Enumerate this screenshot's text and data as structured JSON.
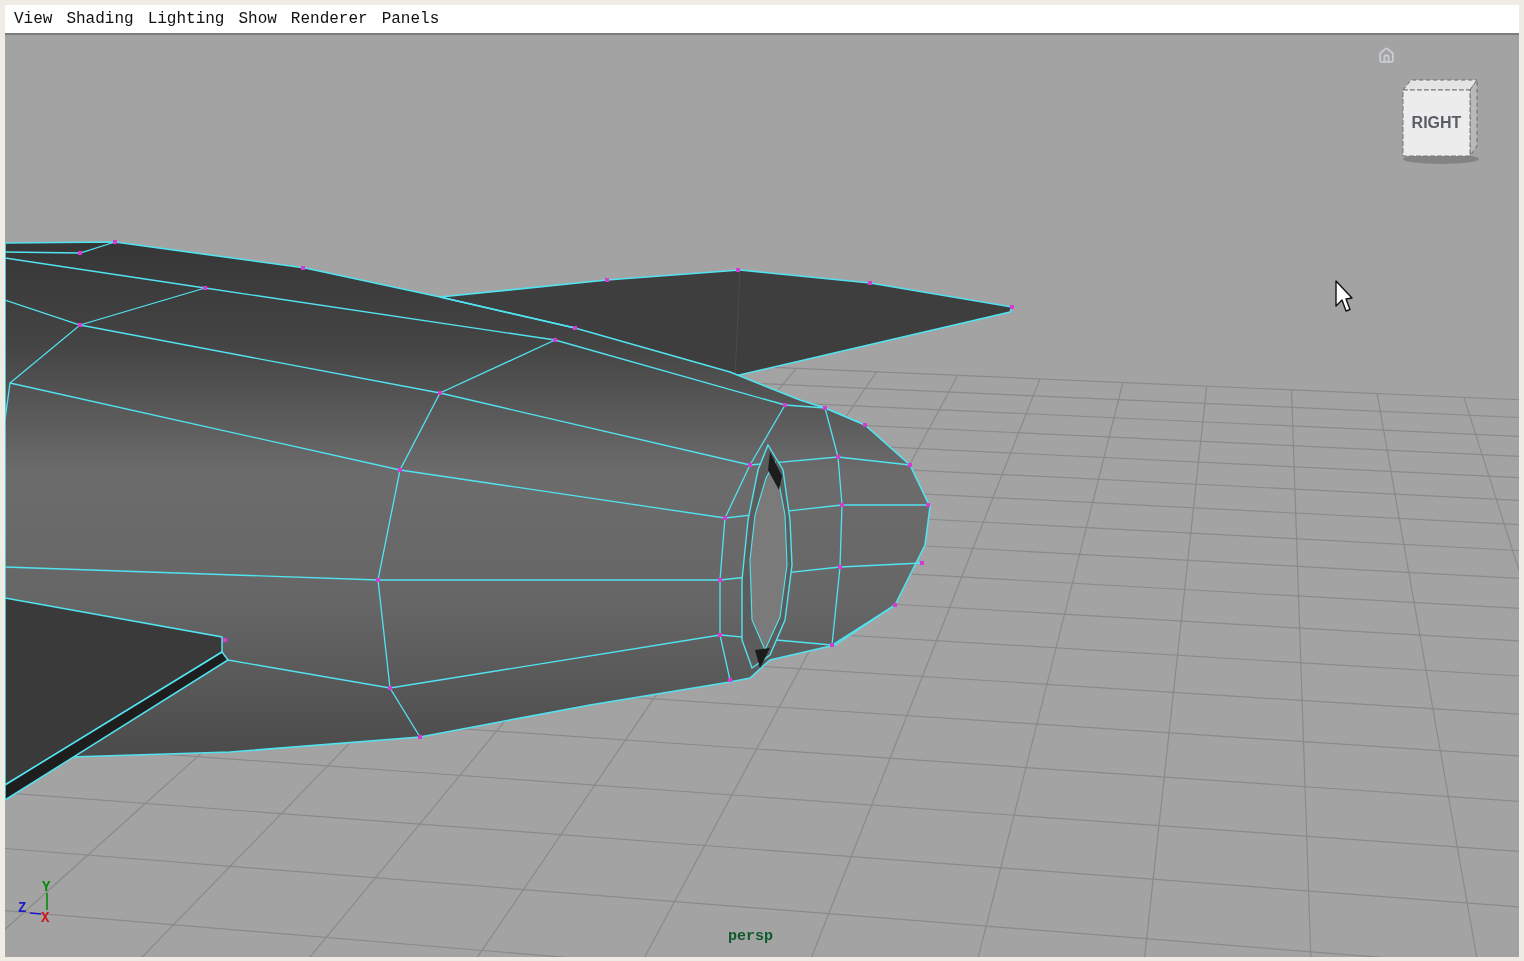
{
  "menu_bar": {
    "items": [
      "View",
      "Shading",
      "Lighting",
      "Show",
      "Renderer",
      "Panels"
    ]
  },
  "viewport": {
    "view_cube": {
      "label": "RIGHT"
    },
    "axis_indicator": [
      {
        "label": "Y",
        "color": "#068a06"
      },
      {
        "label": "Z",
        "color": "#1c1cc8"
      },
      {
        "label": "X",
        "color": "#d01616"
      }
    ],
    "camera_label": "persp"
  }
}
